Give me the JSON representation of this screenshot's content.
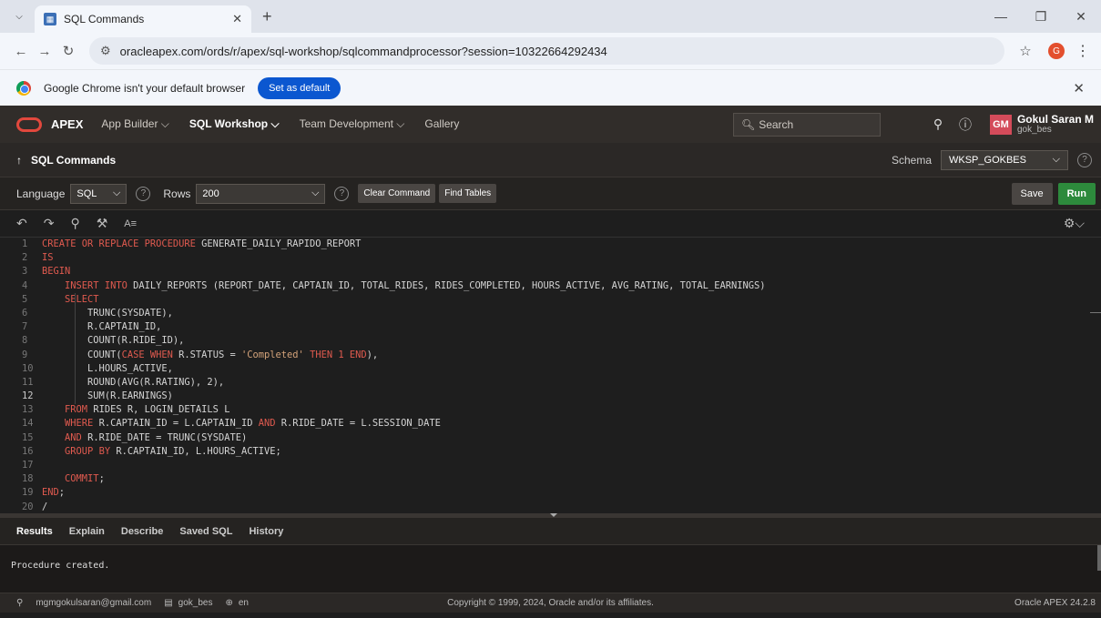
{
  "browser": {
    "tab_title": "SQL Commands",
    "url": "oracleapex.com/ords/r/apex/sql-workshop/sqlcommandprocessor?session=10322664292434",
    "profile_initial": "G",
    "infobar_text": "Google Chrome isn't your default browser",
    "infobar_button": "Set as default"
  },
  "apex": {
    "brand": "APEX",
    "nav": [
      {
        "label": "App Builder ⌵",
        "active": false
      },
      {
        "label": "SQL Workshop ⌵",
        "active": true
      },
      {
        "label": "Team Development ⌵",
        "active": false
      },
      {
        "label": "Gallery",
        "active": false
      }
    ],
    "search_placeholder": "Search",
    "user_initials": "GM",
    "user_name": "Gokul Saran M",
    "user_id": "gok_bes"
  },
  "page": {
    "title": "SQL Commands",
    "schema_label": "Schema",
    "schema_value": "WKSP_GOKBES"
  },
  "toolbar": {
    "language_label": "Language",
    "language_value": "SQL",
    "rows_label": "Rows",
    "rows_value": "200",
    "clear_command": "Clear Command",
    "find_tables": "Find Tables",
    "save": "Save",
    "run": "Run"
  },
  "editor": {
    "current_line": 12,
    "lines": [
      [
        [
          "kw",
          "CREATE OR REPLACE PROCEDURE "
        ],
        [
          "c",
          "GENERATE_DAILY_RAPIDO_REPORT"
        ]
      ],
      [
        [
          "kw",
          "IS"
        ]
      ],
      [
        [
          "kw",
          "BEGIN"
        ]
      ],
      [
        [
          "c",
          "    "
        ],
        [
          "kw",
          "INSERT INTO "
        ],
        [
          "c",
          "DAILY_REPORTS (REPORT_DATE, CAPTAIN_ID, TOTAL_RIDES, RIDES_COMPLETED, HOURS_ACTIVE, AVG_RATING, TOTAL_EARNINGS)"
        ]
      ],
      [
        [
          "c",
          "    "
        ],
        [
          "kw",
          "SELECT"
        ]
      ],
      [
        [
          "c",
          "        TRUNC(SYSDATE),"
        ]
      ],
      [
        [
          "c",
          "        R.CAPTAIN_ID,"
        ]
      ],
      [
        [
          "c",
          "        COUNT(R.RIDE_ID),"
        ]
      ],
      [
        [
          "c",
          "        COUNT("
        ],
        [
          "kw",
          "CASE WHEN "
        ],
        [
          "c",
          "R.STATUS = "
        ],
        [
          "str",
          "'Completed'"
        ],
        [
          "kw",
          " THEN "
        ],
        [
          "num",
          "1"
        ],
        [
          "kw",
          " END"
        ],
        [
          "c",
          "),"
        ]
      ],
      [
        [
          "c",
          "        L.HOURS_ACTIVE,"
        ]
      ],
      [
        [
          "c",
          "        ROUND(AVG(R.RATING), 2),"
        ]
      ],
      [
        [
          "c",
          "        SUM(R.EARNINGS)"
        ]
      ],
      [
        [
          "c",
          "    "
        ],
        [
          "kw",
          "FROM "
        ],
        [
          "c",
          "RIDES R, LOGIN_DETAILS L"
        ]
      ],
      [
        [
          "c",
          "    "
        ],
        [
          "kw",
          "WHERE "
        ],
        [
          "c",
          "R.CAPTAIN_ID = L.CAPTAIN_ID "
        ],
        [
          "kw",
          "AND "
        ],
        [
          "c",
          "R.RIDE_DATE = L.SESSION_DATE"
        ]
      ],
      [
        [
          "c",
          "    "
        ],
        [
          "kw",
          "AND "
        ],
        [
          "c",
          "R.RIDE_DATE = TRUNC(SYSDATE)"
        ]
      ],
      [
        [
          "c",
          "    "
        ],
        [
          "kw",
          "GROUP BY "
        ],
        [
          "c",
          "R.CAPTAIN_ID, L.HOURS_ACTIVE;"
        ]
      ],
      [
        [
          "c",
          ""
        ]
      ],
      [
        [
          "c",
          "    "
        ],
        [
          "kw",
          "COMMIT"
        ],
        [
          "c",
          ";"
        ]
      ],
      [
        [
          "kw",
          "END"
        ],
        [
          "c",
          ";"
        ]
      ],
      [
        [
          "c",
          "/"
        ]
      ]
    ]
  },
  "results": {
    "tabs": [
      "Results",
      "Explain",
      "Describe",
      "Saved SQL",
      "History"
    ],
    "active_tab": 0,
    "output": "Procedure created."
  },
  "footer": {
    "email": "mgmgokulsaran@gmail.com",
    "workspace": "gok_bes",
    "language": "en",
    "copyright": "Copyright © 1999, 2024, Oracle and/or its affiliates.",
    "version": "Oracle APEX 24.2.8"
  },
  "colors": {
    "keyword": "#e05a4f",
    "string": "#d4a37a",
    "run_button": "#2d8a3c",
    "apex_logo": "#e2483d"
  }
}
